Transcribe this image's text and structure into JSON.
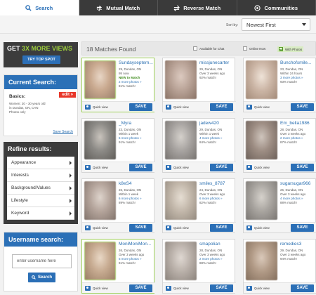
{
  "tabs": [
    {
      "label": "Search",
      "icon": "search-icon",
      "active": true
    },
    {
      "label": "Mutual Match",
      "icon": "mutual-match-icon",
      "active": false
    },
    {
      "label": "Reverse Match",
      "icon": "reverse-match-icon",
      "active": false
    },
    {
      "label": "Communities",
      "icon": "communities-icon",
      "active": false
    }
  ],
  "sort": {
    "label": "Sort by:",
    "value": "Newest First"
  },
  "promo": {
    "title_a": "GET ",
    "title_hl": "3X MORE VIEWS",
    "button": "TRY TOP SPOT"
  },
  "current_search": {
    "title": "Current Search:",
    "edit": "edit »",
    "basics_title": "Basics:",
    "lines": [
      "Women: 20 - 30 years old",
      "in Dundas, ON, CAN",
      "Photos only"
    ],
    "save": "Save Search"
  },
  "refine": {
    "title": "Refine results:",
    "items": [
      "Appearance",
      "Interests",
      "Background/Values",
      "Lifestyle",
      "Keyword"
    ]
  },
  "username": {
    "title": "Username search:",
    "placeholder": "enter username here",
    "button": "Search"
  },
  "results": {
    "count": "18 Matches Found",
    "filters": [
      "Available for Chat",
      "Online Now",
      "With Photos"
    ]
  },
  "card_ui": {
    "quick_view": "Quick view",
    "save": "SAVE"
  },
  "cards": [
    {
      "name": "Sundayseptem...",
      "age_loc": "29, Dundas, ON",
      "line2": "IM now",
      "line3": "NEW to Match",
      "line4": "2 more photos »",
      "match": "81% match!",
      "highlight": true
    },
    {
      "name": "missjunecarter",
      "age_loc": "29, Dundas, ON",
      "line2": "Over 3 weeks ago",
      "line3": "",
      "line4": "",
      "match": "92% match!",
      "highlight": false
    },
    {
      "name": "Bunchofsmile...",
      "age_loc": "23, Dundas, ON",
      "line2": "Within 24 hours",
      "line3": "3 more photos »",
      "line4": "",
      "match": "93% match!",
      "highlight": false
    },
    {
      "name": "_Myra",
      "age_loc": "23, Dundas, ON",
      "line2": "Within 1 week",
      "line3": "6 more photos »",
      "line4": "",
      "match": "91% match!",
      "highlight": false
    },
    {
      "name": "jadew420",
      "age_loc": "29, Dundas, ON",
      "line2": "Within 1 week",
      "line3": "4 more photos »",
      "line4": "",
      "match": "84% match!",
      "highlight": false
    },
    {
      "name": "Em_bella1986",
      "age_loc": "28, Dundas, ON",
      "line2": "Over 3 weeks ago",
      "line3": "2 more photos »",
      "line4": "",
      "match": "87% match!",
      "highlight": false
    },
    {
      "name": "k8eS4",
      "age_loc": "26, Dundas, ON",
      "line2": "Within 1 week",
      "line3": "6 more photos »",
      "line4": "",
      "match": "89% match!",
      "highlight": false
    },
    {
      "name": "smiles_8787",
      "age_loc": "24, Dundas, ON",
      "line2": "Over 3 weeks ago",
      "line3": "6 more photos »",
      "line4": "",
      "match": "82% match!",
      "highlight": false
    },
    {
      "name": "sugarsugar966",
      "age_loc": "26, Dundas, ON",
      "line2": "Over 3 weeks ago",
      "line3": "4 more photos »",
      "line4": "",
      "match": "88% match!",
      "highlight": false
    },
    {
      "name": "MoniMoniMon...",
      "age_loc": "26, Dundas, ON",
      "line2": "Over 3 weeks ago",
      "line3": "5 more photos »",
      "line4": "",
      "match": "91% match!",
      "highlight": true
    },
    {
      "name": "smapolian",
      "age_loc": "28, Dundas, ON",
      "line2": "Over 3 weeks ago",
      "line3": "2 more photos »",
      "line4": "",
      "match": "88% match!",
      "highlight": false
    },
    {
      "name": "remedies3",
      "age_loc": "29, Dundas, ON",
      "line2": "Over 3 weeks ago",
      "line3": "",
      "line4": "",
      "match": "94% match!",
      "highlight": false
    }
  ],
  "colors": {
    "accent": "#2b6fb6",
    "promo_green": "#9ccc3c",
    "dark": "#3c3c3c",
    "edit_red": "#e8372a"
  }
}
